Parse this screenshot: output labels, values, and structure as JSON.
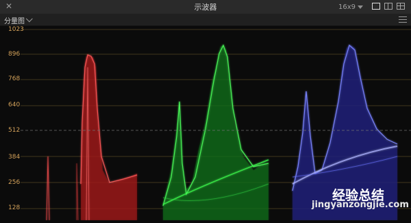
{
  "window": {
    "title": "示波器",
    "close_icon": "close-icon",
    "aspect_label": "16x9",
    "view_buttons": [
      "single-view-icon",
      "split-view-icon",
      "quad-view-icon"
    ]
  },
  "toolbar": {
    "mode_label": "分量图",
    "settings_icon": "sliders-icon"
  },
  "scope": {
    "y_ticks": [
      "1023",
      "896",
      "768",
      "640",
      "512",
      "384",
      "256",
      "128"
    ],
    "channels": [
      {
        "name": "red",
        "color": "#ff4a4a"
      },
      {
        "name": "green",
        "color": "#39ff4f"
      },
      {
        "name": "blue",
        "color": "#5f6bff"
      }
    ],
    "grid_color": "#6e5a2a",
    "mid_line_color": "#707070"
  },
  "watermark": {
    "title": "经验总结",
    "url": "jingyanzongjie.com"
  }
}
